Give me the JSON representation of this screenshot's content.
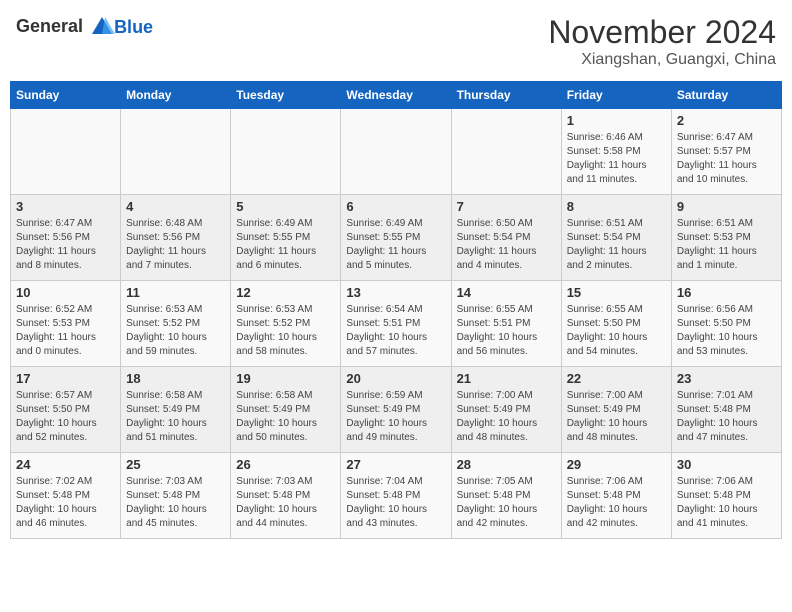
{
  "header": {
    "logo_line1": "General",
    "logo_line2": "Blue",
    "month_year": "November 2024",
    "location": "Xiangshan, Guangxi, China"
  },
  "weekdays": [
    "Sunday",
    "Monday",
    "Tuesday",
    "Wednesday",
    "Thursday",
    "Friday",
    "Saturday"
  ],
  "weeks": [
    [
      {
        "day": "",
        "info": ""
      },
      {
        "day": "",
        "info": ""
      },
      {
        "day": "",
        "info": ""
      },
      {
        "day": "",
        "info": ""
      },
      {
        "day": "",
        "info": ""
      },
      {
        "day": "1",
        "info": "Sunrise: 6:46 AM\nSunset: 5:58 PM\nDaylight: 11 hours\nand 11 minutes."
      },
      {
        "day": "2",
        "info": "Sunrise: 6:47 AM\nSunset: 5:57 PM\nDaylight: 11 hours\nand 10 minutes."
      }
    ],
    [
      {
        "day": "3",
        "info": "Sunrise: 6:47 AM\nSunset: 5:56 PM\nDaylight: 11 hours\nand 8 minutes."
      },
      {
        "day": "4",
        "info": "Sunrise: 6:48 AM\nSunset: 5:56 PM\nDaylight: 11 hours\nand 7 minutes."
      },
      {
        "day": "5",
        "info": "Sunrise: 6:49 AM\nSunset: 5:55 PM\nDaylight: 11 hours\nand 6 minutes."
      },
      {
        "day": "6",
        "info": "Sunrise: 6:49 AM\nSunset: 5:55 PM\nDaylight: 11 hours\nand 5 minutes."
      },
      {
        "day": "7",
        "info": "Sunrise: 6:50 AM\nSunset: 5:54 PM\nDaylight: 11 hours\nand 4 minutes."
      },
      {
        "day": "8",
        "info": "Sunrise: 6:51 AM\nSunset: 5:54 PM\nDaylight: 11 hours\nand 2 minutes."
      },
      {
        "day": "9",
        "info": "Sunrise: 6:51 AM\nSunset: 5:53 PM\nDaylight: 11 hours\nand 1 minute."
      }
    ],
    [
      {
        "day": "10",
        "info": "Sunrise: 6:52 AM\nSunset: 5:53 PM\nDaylight: 11 hours\nand 0 minutes."
      },
      {
        "day": "11",
        "info": "Sunrise: 6:53 AM\nSunset: 5:52 PM\nDaylight: 10 hours\nand 59 minutes."
      },
      {
        "day": "12",
        "info": "Sunrise: 6:53 AM\nSunset: 5:52 PM\nDaylight: 10 hours\nand 58 minutes."
      },
      {
        "day": "13",
        "info": "Sunrise: 6:54 AM\nSunset: 5:51 PM\nDaylight: 10 hours\nand 57 minutes."
      },
      {
        "day": "14",
        "info": "Sunrise: 6:55 AM\nSunset: 5:51 PM\nDaylight: 10 hours\nand 56 minutes."
      },
      {
        "day": "15",
        "info": "Sunrise: 6:55 AM\nSunset: 5:50 PM\nDaylight: 10 hours\nand 54 minutes."
      },
      {
        "day": "16",
        "info": "Sunrise: 6:56 AM\nSunset: 5:50 PM\nDaylight: 10 hours\nand 53 minutes."
      }
    ],
    [
      {
        "day": "17",
        "info": "Sunrise: 6:57 AM\nSunset: 5:50 PM\nDaylight: 10 hours\nand 52 minutes."
      },
      {
        "day": "18",
        "info": "Sunrise: 6:58 AM\nSunset: 5:49 PM\nDaylight: 10 hours\nand 51 minutes."
      },
      {
        "day": "19",
        "info": "Sunrise: 6:58 AM\nSunset: 5:49 PM\nDaylight: 10 hours\nand 50 minutes."
      },
      {
        "day": "20",
        "info": "Sunrise: 6:59 AM\nSunset: 5:49 PM\nDaylight: 10 hours\nand 49 minutes."
      },
      {
        "day": "21",
        "info": "Sunrise: 7:00 AM\nSunset: 5:49 PM\nDaylight: 10 hours\nand 48 minutes."
      },
      {
        "day": "22",
        "info": "Sunrise: 7:00 AM\nSunset: 5:49 PM\nDaylight: 10 hours\nand 48 minutes."
      },
      {
        "day": "23",
        "info": "Sunrise: 7:01 AM\nSunset: 5:48 PM\nDaylight: 10 hours\nand 47 minutes."
      }
    ],
    [
      {
        "day": "24",
        "info": "Sunrise: 7:02 AM\nSunset: 5:48 PM\nDaylight: 10 hours\nand 46 minutes."
      },
      {
        "day": "25",
        "info": "Sunrise: 7:03 AM\nSunset: 5:48 PM\nDaylight: 10 hours\nand 45 minutes."
      },
      {
        "day": "26",
        "info": "Sunrise: 7:03 AM\nSunset: 5:48 PM\nDaylight: 10 hours\nand 44 minutes."
      },
      {
        "day": "27",
        "info": "Sunrise: 7:04 AM\nSunset: 5:48 PM\nDaylight: 10 hours\nand 43 minutes."
      },
      {
        "day": "28",
        "info": "Sunrise: 7:05 AM\nSunset: 5:48 PM\nDaylight: 10 hours\nand 42 minutes."
      },
      {
        "day": "29",
        "info": "Sunrise: 7:06 AM\nSunset: 5:48 PM\nDaylight: 10 hours\nand 42 minutes."
      },
      {
        "day": "30",
        "info": "Sunrise: 7:06 AM\nSunset: 5:48 PM\nDaylight: 10 hours\nand 41 minutes."
      }
    ]
  ]
}
